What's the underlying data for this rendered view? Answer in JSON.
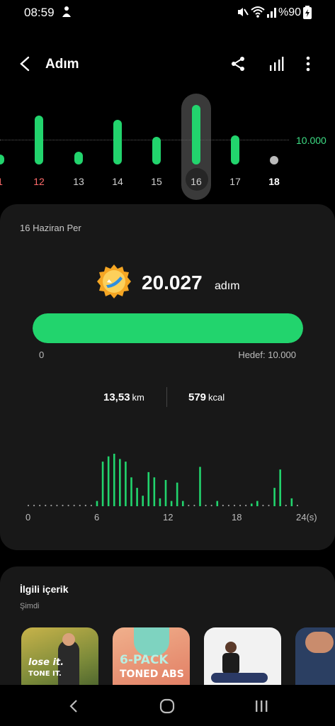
{
  "status_bar": {
    "time": "08:59",
    "battery": "%90"
  },
  "header": {
    "title": "Adım"
  },
  "week_chart": {
    "goal_label": "10.000",
    "days": [
      {
        "label": "1",
        "steps": 3400
      },
      {
        "label": "12",
        "steps": 16500
      },
      {
        "label": "13",
        "steps": 4300
      },
      {
        "label": "14",
        "steps": 15000
      },
      {
        "label": "15",
        "steps": 9300
      },
      {
        "label": "16",
        "steps": 20027
      },
      {
        "label": "17",
        "steps": 9800
      },
      {
        "label": "18",
        "steps": 1000
      }
    ],
    "selected": "16"
  },
  "summary": {
    "date": "16 Haziran Per",
    "steps": "20.027",
    "steps_unit": "adım",
    "progress_fraction": 1.0,
    "progress_min": "0",
    "progress_goal": "Hedef: 10.000",
    "distance_value": "13,53",
    "distance_unit": "km",
    "calories_value": "579",
    "calories_unit": "kcal"
  },
  "chart_data": {
    "type": "bar",
    "x": [
      0,
      0.5,
      1,
      1.5,
      2,
      2.5,
      3,
      3.5,
      4,
      4.5,
      5,
      5.5,
      6,
      6.5,
      7,
      7.5,
      8,
      8.5,
      9,
      9.5,
      10,
      10.5,
      11,
      11.5,
      12,
      12.5,
      13,
      13.5,
      14,
      14.5,
      15,
      15.5,
      16,
      16.5,
      17,
      17.5,
      18,
      18.5,
      19,
      19.5,
      20,
      20.5,
      21,
      21.5,
      22,
      22.5,
      23,
      23.5
    ],
    "values": [
      0,
      0,
      0,
      0,
      0,
      0,
      0,
      0,
      0,
      0,
      0,
      0,
      10,
      85,
      95,
      100,
      90,
      85,
      55,
      35,
      20,
      65,
      55,
      15,
      50,
      10,
      45,
      10,
      0,
      0,
      75,
      0,
      0,
      10,
      0,
      0,
      0,
      0,
      0,
      5,
      10,
      0,
      0,
      35,
      70,
      0,
      15,
      0
    ],
    "x_ticks": [
      "0",
      "6",
      "12",
      "18",
      "24(s)"
    ],
    "xlim": [
      0,
      24
    ],
    "ylim": [
      0,
      100
    ]
  },
  "related": {
    "title": "İlgili içerik",
    "subtitle": "Şimdi",
    "items": [
      {
        "line1": "lose it.",
        "line2": "TONE IT."
      },
      {
        "line1": "6-PACK",
        "line2": "TONED ABS"
      },
      {
        "line1": "",
        "line2": ""
      },
      {
        "line1": "",
        "line2": ""
      }
    ]
  },
  "colors": {
    "accent": "#22d46d",
    "goal": "#3ddc84",
    "card": "#181818"
  }
}
